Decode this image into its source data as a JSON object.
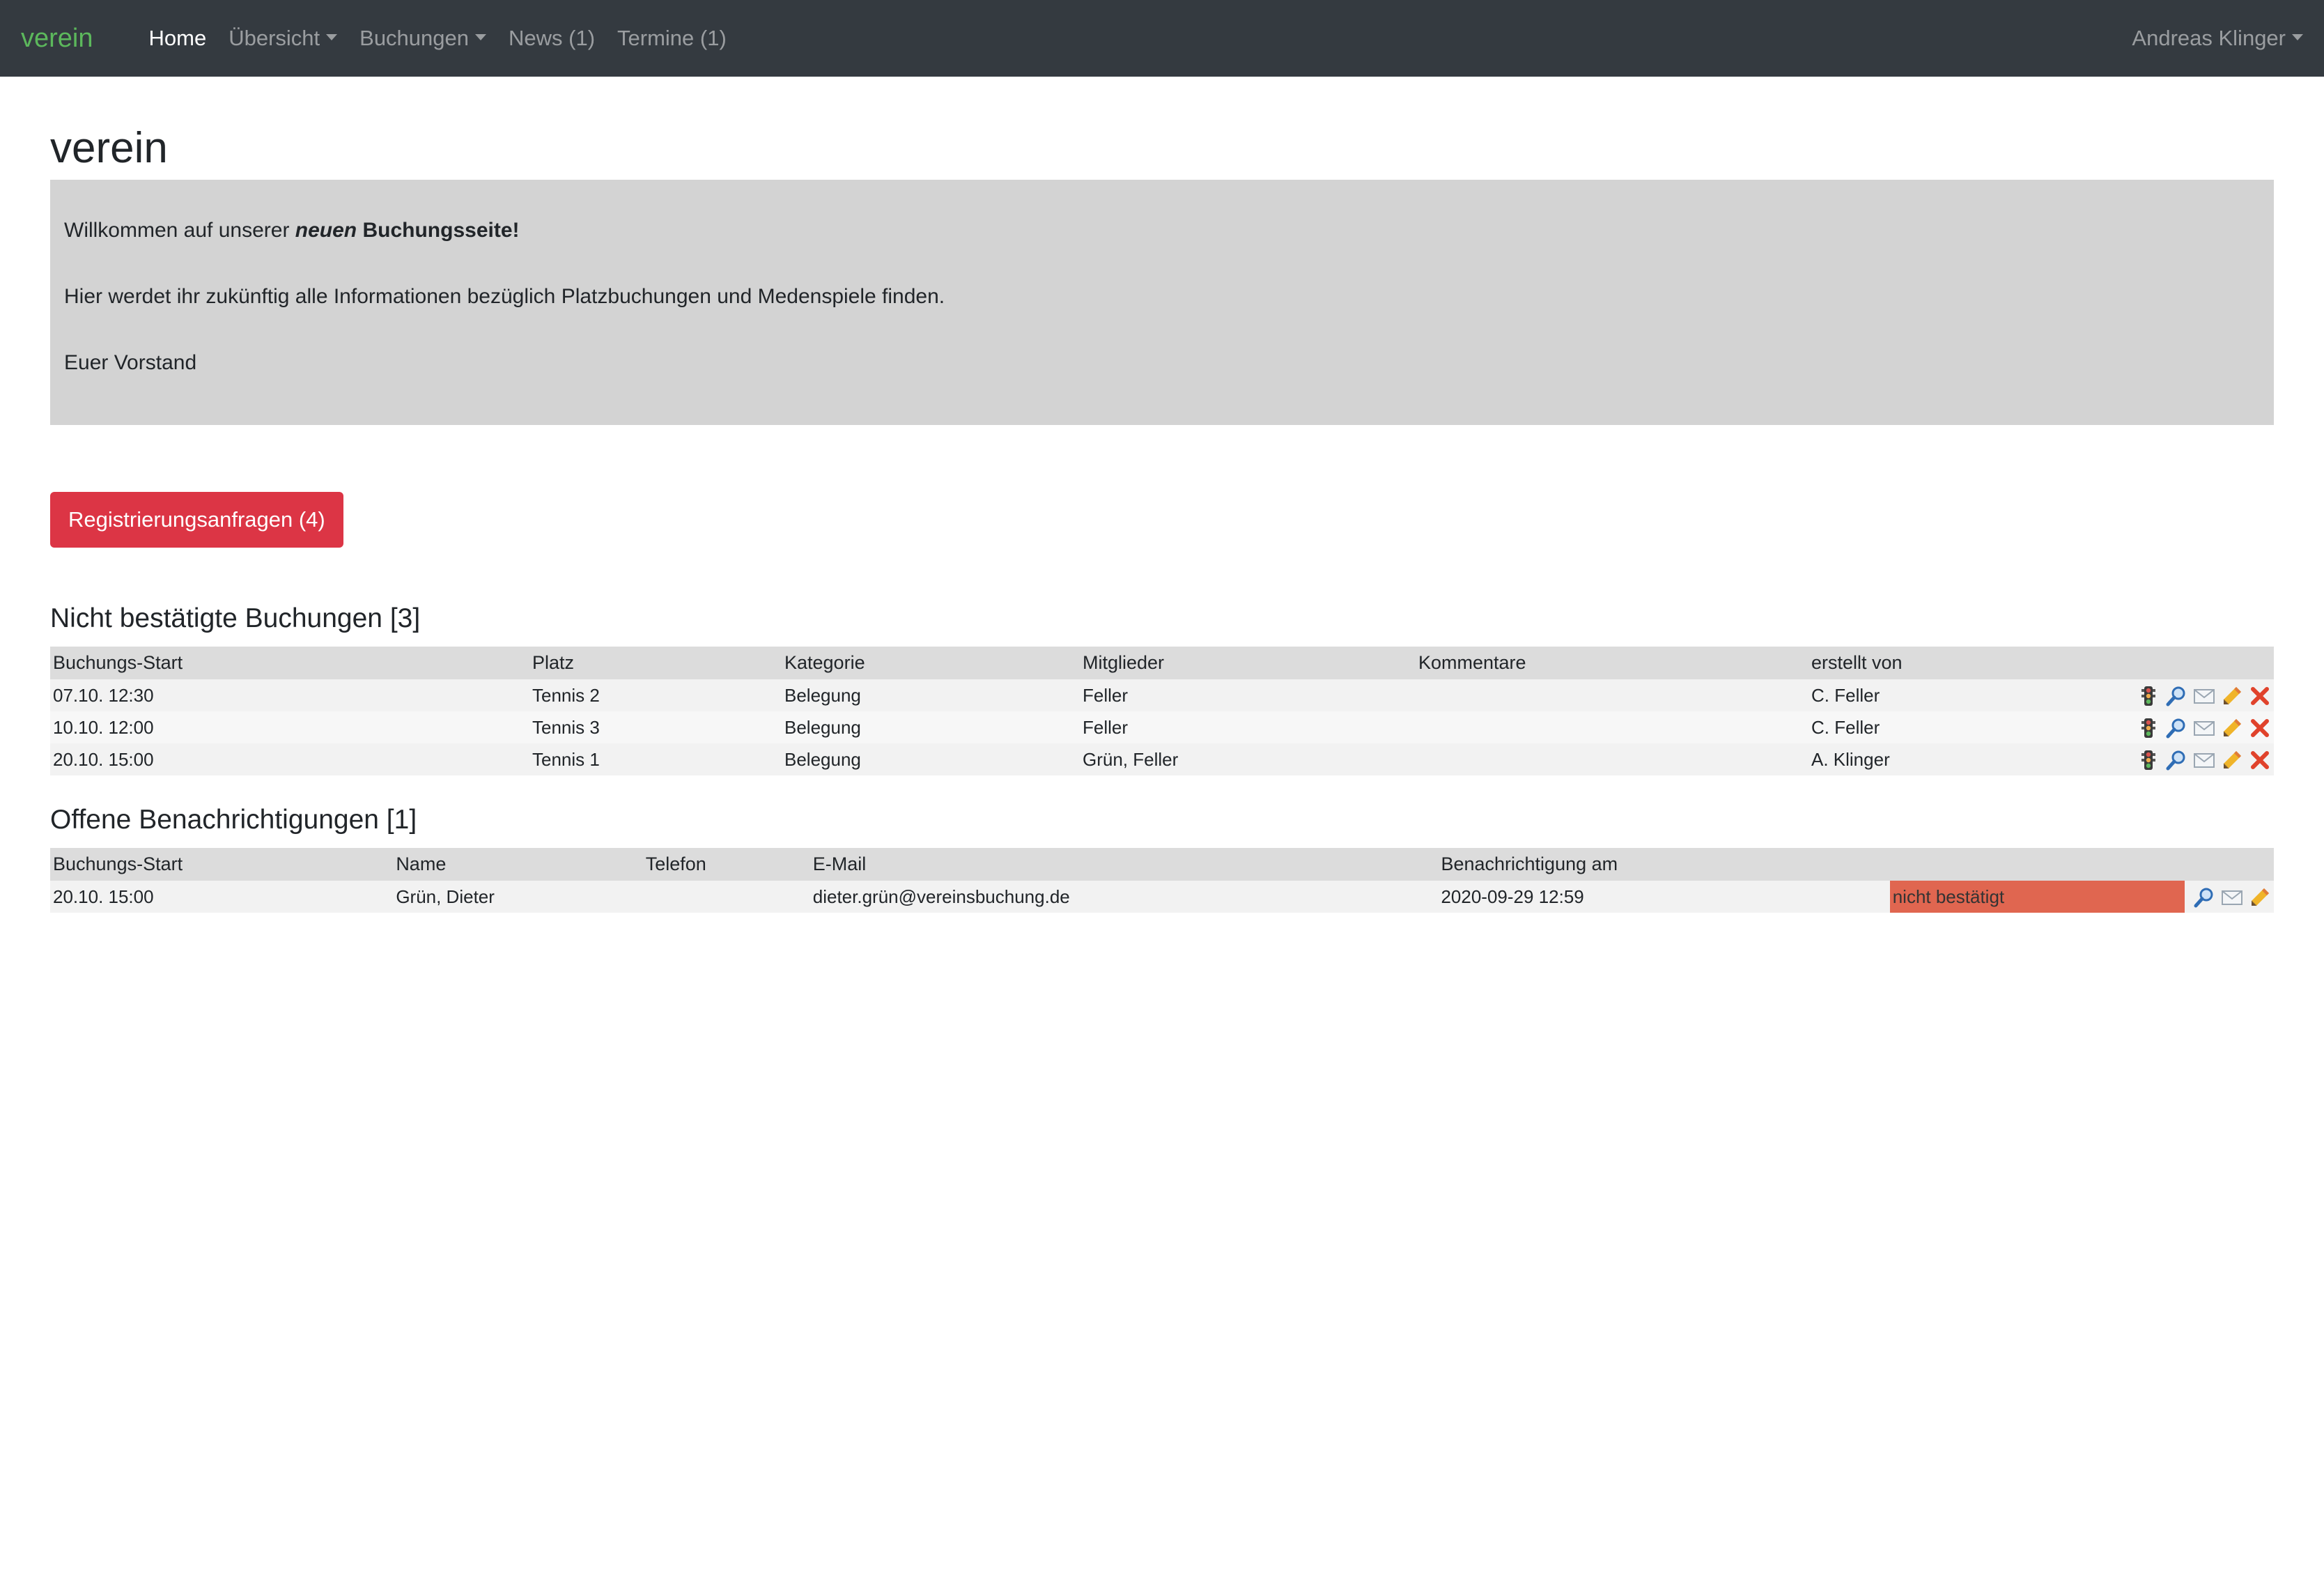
{
  "navbar": {
    "brand": "verein",
    "items": [
      {
        "label": "Home"
      },
      {
        "label": "Übersicht"
      },
      {
        "label": "Buchungen"
      },
      {
        "label": "News (1)"
      },
      {
        "label": "Termine (1)"
      }
    ],
    "user": "Andreas Klinger"
  },
  "page": {
    "title": "verein",
    "welcome": {
      "line1_prefix": "Willkommen auf unserer ",
      "line1_em": "neuen",
      "line1_suffix": " Buchungsseite!",
      "line2": "Hier werdet ihr zukünftig alle Informationen bezüglich Platzbuchungen und Medenspiele finden.",
      "line3": "Euer Vorstand"
    },
    "registration_button": "Registrierungsanfragen (4)"
  },
  "bookings": {
    "title": "Nicht bestätigte Buchungen [3]",
    "headers": [
      "Buchungs-Start",
      "Platz",
      "Kategorie",
      "Mitglieder",
      "Kommentare",
      "erstellt von",
      ""
    ],
    "rows": [
      {
        "start": "07.10. 12:30",
        "platz": "Tennis 2",
        "kategorie": "Belegung",
        "mitglieder": "Feller",
        "kommentare": "",
        "erstellt": "C. Feller"
      },
      {
        "start": "10.10. 12:00",
        "platz": "Tennis 3",
        "kategorie": "Belegung",
        "mitglieder": "Feller",
        "kommentare": "",
        "erstellt": "C. Feller"
      },
      {
        "start": "20.10. 15:00",
        "platz": "Tennis 1",
        "kategorie": "Belegung",
        "mitglieder": "Grün, Feller",
        "kommentare": "",
        "erstellt": "A. Klinger"
      }
    ]
  },
  "notifications": {
    "title": "Offene Benachrichtigungen [1]",
    "headers": [
      "Buchungs-Start",
      "Name",
      "Telefon",
      "E-Mail",
      "Benachrichtigung am",
      "",
      ""
    ],
    "rows": [
      {
        "start": "20.10. 15:00",
        "name": "Grün, Dieter",
        "telefon": "",
        "email": "dieter.grün@vereinsbuchung.de",
        "datum": "2020-09-29 12:59",
        "status": "nicht bestätigt"
      }
    ]
  },
  "colors": {
    "navbar_bg": "#343a40",
    "brand": "#5cb85c",
    "jumbotron_bg": "#d3d3d3",
    "danger": "#dc3545",
    "status_badge": "#e06650"
  },
  "icons": [
    "traffic-light-icon",
    "magnifier-icon",
    "envelope-icon",
    "pencil-icon",
    "delete-x-icon"
  ]
}
